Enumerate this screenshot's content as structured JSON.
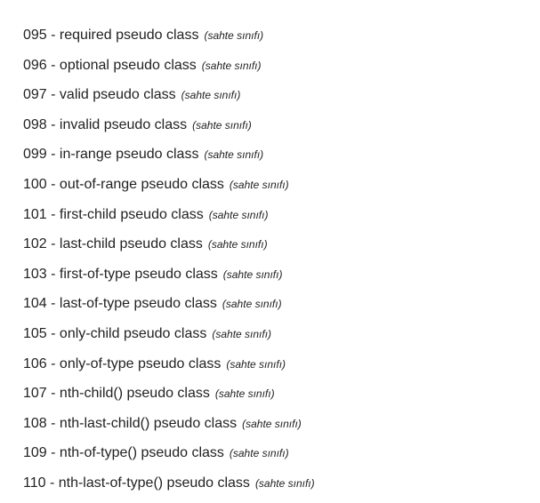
{
  "items": [
    {
      "label": "095 - required pseudo class",
      "note": "(sahte sınıfı)"
    },
    {
      "label": "096 - optional pseudo class",
      "note": "(sahte sınıfı)"
    },
    {
      "label": "097 - valid pseudo class",
      "note": "(sahte sınıfı)"
    },
    {
      "label": "098 - invalid pseudo class",
      "note": "(sahte sınıfı)"
    },
    {
      "label": "099 - in-range pseudo class",
      "note": "(sahte sınıfı)"
    },
    {
      "label": "100 - out-of-range pseudo class",
      "note": "(sahte sınıfı)"
    },
    {
      "label": "101 - first-child pseudo class",
      "note": "(sahte sınıfı)"
    },
    {
      "label": "102 - last-child pseudo class",
      "note": "(sahte sınıfı)"
    },
    {
      "label": "103 - first-of-type pseudo class",
      "note": "(sahte sınıfı)"
    },
    {
      "label": "104 - last-of-type pseudo class",
      "note": "(sahte sınıfı)"
    },
    {
      "label": "105 - only-child pseudo class",
      "note": "(sahte sınıfı)"
    },
    {
      "label": "106 - only-of-type pseudo class",
      "note": "(sahte sınıfı)"
    },
    {
      "label": "107 - nth-child() pseudo class",
      "note": "(sahte sınıfı)"
    },
    {
      "label": "108 - nth-last-child() pseudo class",
      "note": "(sahte sınıfı)"
    },
    {
      "label": "109 - nth-of-type() pseudo class",
      "note": "(sahte sınıfı)"
    },
    {
      "label": "110 - nth-last-of-type() pseudo class",
      "note": "(sahte sınıfı)"
    }
  ]
}
